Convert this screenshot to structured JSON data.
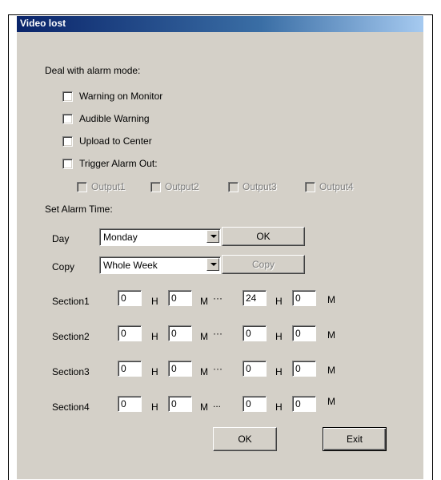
{
  "dialog": {
    "title": "Video lost"
  },
  "alarm_mode": {
    "label": "Deal with alarm mode:",
    "options": [
      {
        "label": "Warning on Monitor",
        "checked": false
      },
      {
        "label": "Audible Warning",
        "checked": false
      },
      {
        "label": "Upload to Center",
        "checked": false
      },
      {
        "label": "Trigger Alarm Out:",
        "checked": false
      }
    ],
    "outputs": [
      {
        "label": "Output1",
        "checked": false
      },
      {
        "label": "Output2",
        "checked": false
      },
      {
        "label": "Output3",
        "checked": false
      },
      {
        "label": "Output4",
        "checked": false
      }
    ]
  },
  "alarm_time": {
    "label": "Set Alarm Time:",
    "day_label": "Day",
    "day_value": "Monday",
    "copy_label": "Copy",
    "copy_value": "Whole Week",
    "ok_label": "OK",
    "copy_button_label": "Copy",
    "hour_unit": "H",
    "minute_unit": "M",
    "sections": [
      {
        "label": "Section1",
        "start_h": "0",
        "start_m": "0",
        "sep": "···",
        "end_h": "24",
        "end_m": "0"
      },
      {
        "label": "Section2",
        "start_h": "0",
        "start_m": "0",
        "sep": "···",
        "end_h": "0",
        "end_m": "0"
      },
      {
        "label": "Section3",
        "start_h": "0",
        "start_m": "0",
        "sep": "···",
        "end_h": "0",
        "end_m": "0"
      },
      {
        "label": "Section4",
        "start_h": "0",
        "start_m": "0",
        "sep": "...",
        "end_h": "0",
        "end_m": "0"
      }
    ]
  },
  "footer": {
    "ok_label": "OK",
    "exit_label": "Exit"
  }
}
